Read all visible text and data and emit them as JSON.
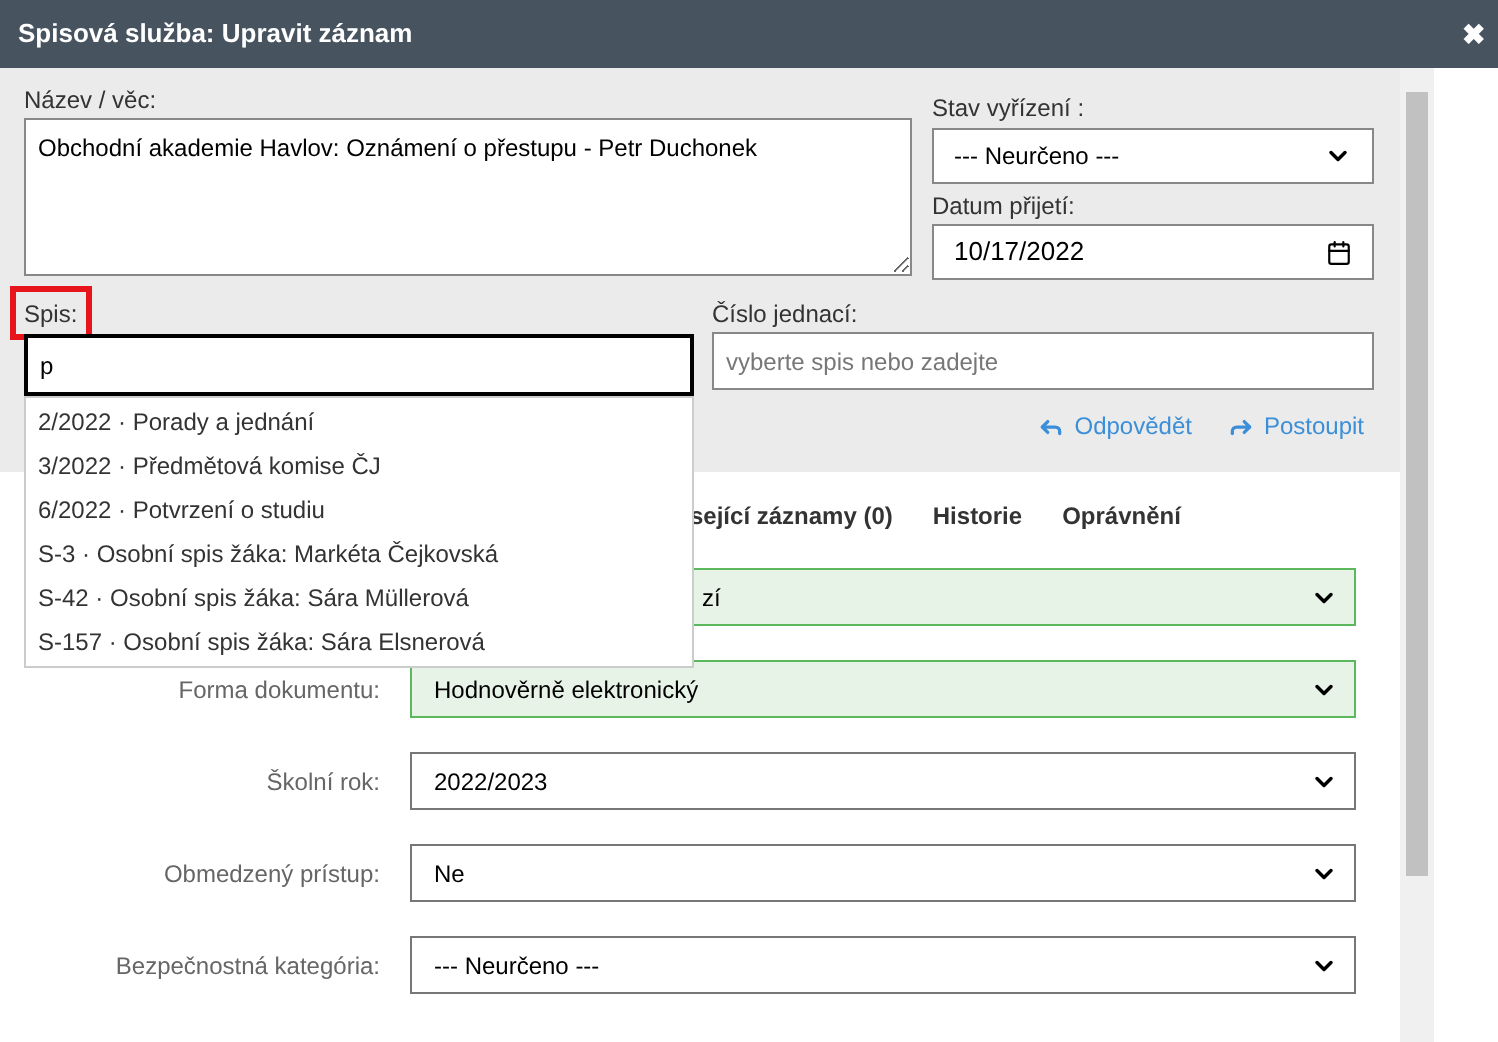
{
  "window": {
    "title": "Spisová služba: Upravit záznam",
    "close": "✖"
  },
  "subject": {
    "label": "Název / věc:",
    "value": "Obchodní akademie Havlov: Oznámení o přestupu - Petr Duchonek"
  },
  "status": {
    "label": "Stav vyřízení :",
    "value": "--- Neurčeno ---"
  },
  "received": {
    "label": "Datum přijetí:",
    "value": "10/17/2022"
  },
  "file": {
    "label": "Spis:",
    "value": "p",
    "highlighted": true
  },
  "reference": {
    "label": "Číslo jednací:",
    "placeholder": "vyberte spis nebo zadejte"
  },
  "actions": [
    {
      "label": "Odpovědět",
      "kind": "reply"
    },
    {
      "label": "Postoupit",
      "kind": "forward"
    }
  ],
  "suggestions": [
    "2/2022 · Porady a jednání",
    "3/2022 · Předmětová komise ČJ",
    "6/2022 · Potvrzení o studiu",
    "S-3 · Osobní spis žáka: Markéta Čejkovská",
    "S-42 · Osobní spis žáka: Sára Müllerová",
    "S-157 · Osobní spis žáka: Sára Elsnerová"
  ],
  "tabs": [
    {
      "label": "sející záznamy (0)",
      "selected": false
    },
    {
      "label": "Historie",
      "selected": false
    },
    {
      "label": "Oprávnění",
      "selected": false
    }
  ],
  "fields": [
    {
      "value": "zí",
      "covered": true,
      "valid": true
    },
    {
      "label": "Forma dokumentu:",
      "value": "Hodnověrně elektronický",
      "covered": false,
      "valid": true
    },
    {
      "label": "Školní rok:",
      "value": "2022/2023",
      "covered": false,
      "valid": false
    },
    {
      "label": "Obmedzený prístup:",
      "value": "Ne",
      "covered": false,
      "valid": false
    },
    {
      "label": "Bezpečnostná kategória:",
      "value": "--- Neurčeno ---",
      "covered": false,
      "valid": false
    }
  ]
}
